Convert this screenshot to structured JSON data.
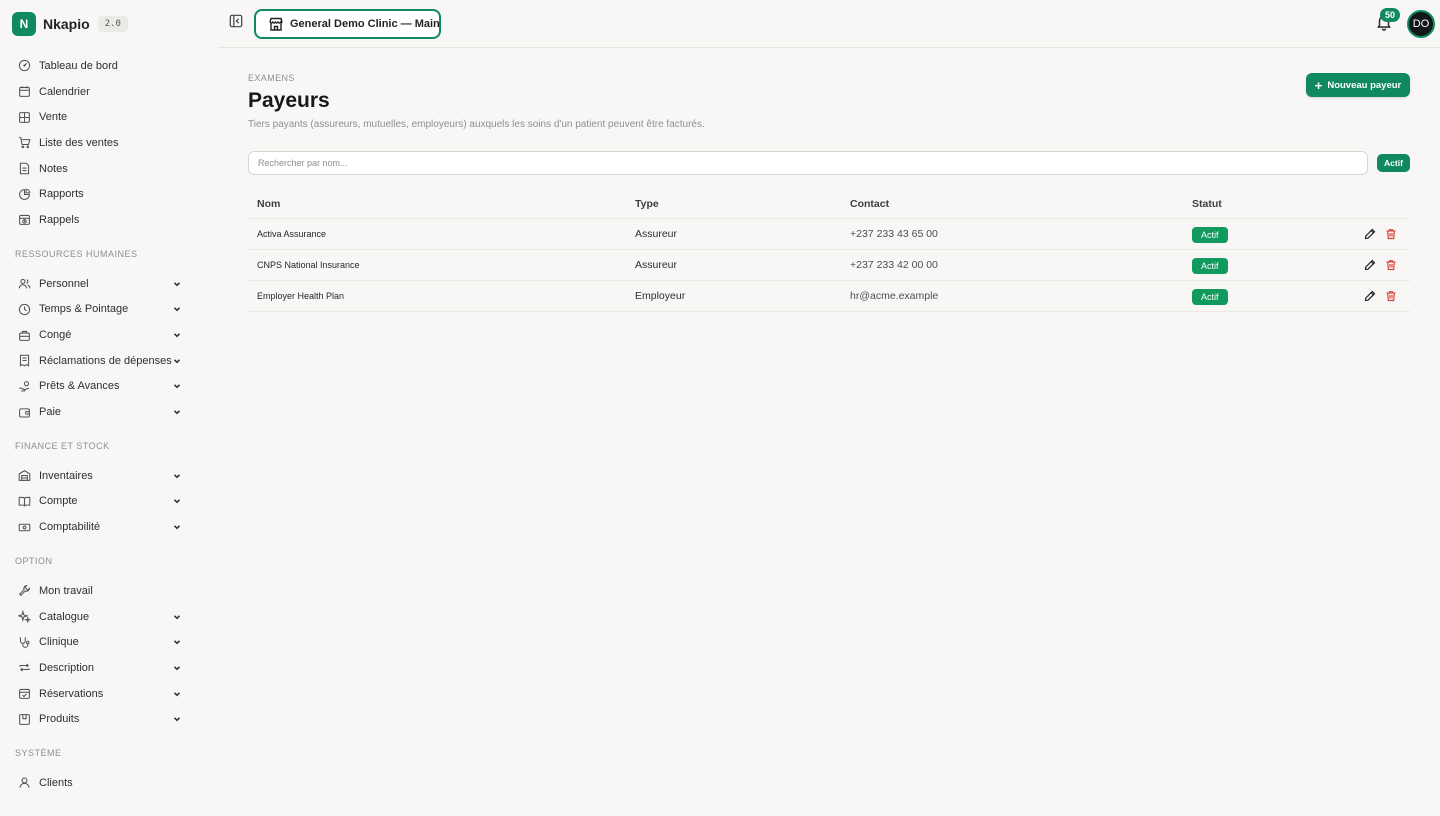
{
  "brand": {
    "logo_letter": "N",
    "name": "Nkapio",
    "version": "2.0"
  },
  "sidebar": {
    "top_items": [
      {
        "label": "Tableau de bord",
        "icon": "dashboard-icon"
      },
      {
        "label": "Calendrier",
        "icon": "calendar-icon"
      },
      {
        "label": "Vente",
        "icon": "grid-icon"
      },
      {
        "label": "Liste des ventes",
        "icon": "cart-icon"
      },
      {
        "label": "Notes",
        "icon": "note-icon"
      },
      {
        "label": "Rapports",
        "icon": "chart-pie-icon"
      },
      {
        "label": "Rappels",
        "icon": "calendar-clock-icon"
      }
    ],
    "sections": [
      {
        "title": "RESSOURCES HUMAINES",
        "items": [
          {
            "label": "Personnel",
            "icon": "users-icon",
            "expandable": true
          },
          {
            "label": "Temps & Pointage",
            "icon": "clock-icon",
            "expandable": true
          },
          {
            "label": "Congé",
            "icon": "briefcase-icon",
            "expandable": true
          },
          {
            "label": "Réclamations de dépenses",
            "icon": "receipt-icon",
            "expandable": true
          },
          {
            "label": "Prêts & Avances",
            "icon": "hand-coins-icon",
            "expandable": true
          },
          {
            "label": "Paie",
            "icon": "wallet-icon",
            "expandable": true
          }
        ]
      },
      {
        "title": "FINANCE ET STOCK",
        "items": [
          {
            "label": "Inventaires",
            "icon": "warehouse-icon",
            "expandable": true
          },
          {
            "label": "Compte",
            "icon": "book-icon",
            "expandable": true
          },
          {
            "label": "Comptabilité",
            "icon": "banknote-icon",
            "expandable": true
          }
        ]
      },
      {
        "title": "OPTION",
        "items": [
          {
            "label": "Mon travail",
            "icon": "wrench-icon",
            "expandable": false
          },
          {
            "label": "Catalogue",
            "icon": "sparkles-icon",
            "expandable": true
          },
          {
            "label": "Clinique",
            "icon": "stethoscope-icon",
            "expandable": true
          },
          {
            "label": "Description",
            "icon": "repeat-icon",
            "expandable": true
          },
          {
            "label": "Réservations",
            "icon": "calendar-check-icon",
            "expandable": true
          },
          {
            "label": "Produits",
            "icon": "package-icon",
            "expandable": true
          }
        ]
      },
      {
        "title": "SYSTÈME",
        "items": [
          {
            "label": "Clients",
            "icon": "user-icon",
            "expandable": false
          }
        ]
      }
    ]
  },
  "topbar": {
    "clinic_label": "General Demo Clinic — Main",
    "notifications_count": "50",
    "avatar_initials": "DO"
  },
  "page": {
    "breadcrumb": "EXAMENS",
    "title": "Payeurs",
    "subtitle": "Tiers payants (assureurs, mutuelles, employeurs) auxquels les soins d'un patient peuvent être facturés.",
    "new_button": "Nouveau payeur",
    "search_placeholder": "Rechercher par nom...",
    "filter_button": "Actif"
  },
  "table": {
    "headers": {
      "name": "Nom",
      "type": "Type",
      "contact": "Contact",
      "status": "Statut"
    },
    "rows": [
      {
        "name": "Activa Assurance",
        "type": "Assureur",
        "contact": "+237 233 43 65 00",
        "status": "Actif"
      },
      {
        "name": "CNPS National Insurance",
        "type": "Assureur",
        "contact": "+237 233 42 00 00",
        "status": "Actif"
      },
      {
        "name": "Employer Health Plan",
        "type": "Employeur",
        "contact": "hr@acme.example",
        "status": "Actif"
      }
    ]
  },
  "colors": {
    "accent": "#0f8a5f",
    "badge": "#119a5e",
    "danger": "#d6453d",
    "background": "#f8f7f5"
  }
}
